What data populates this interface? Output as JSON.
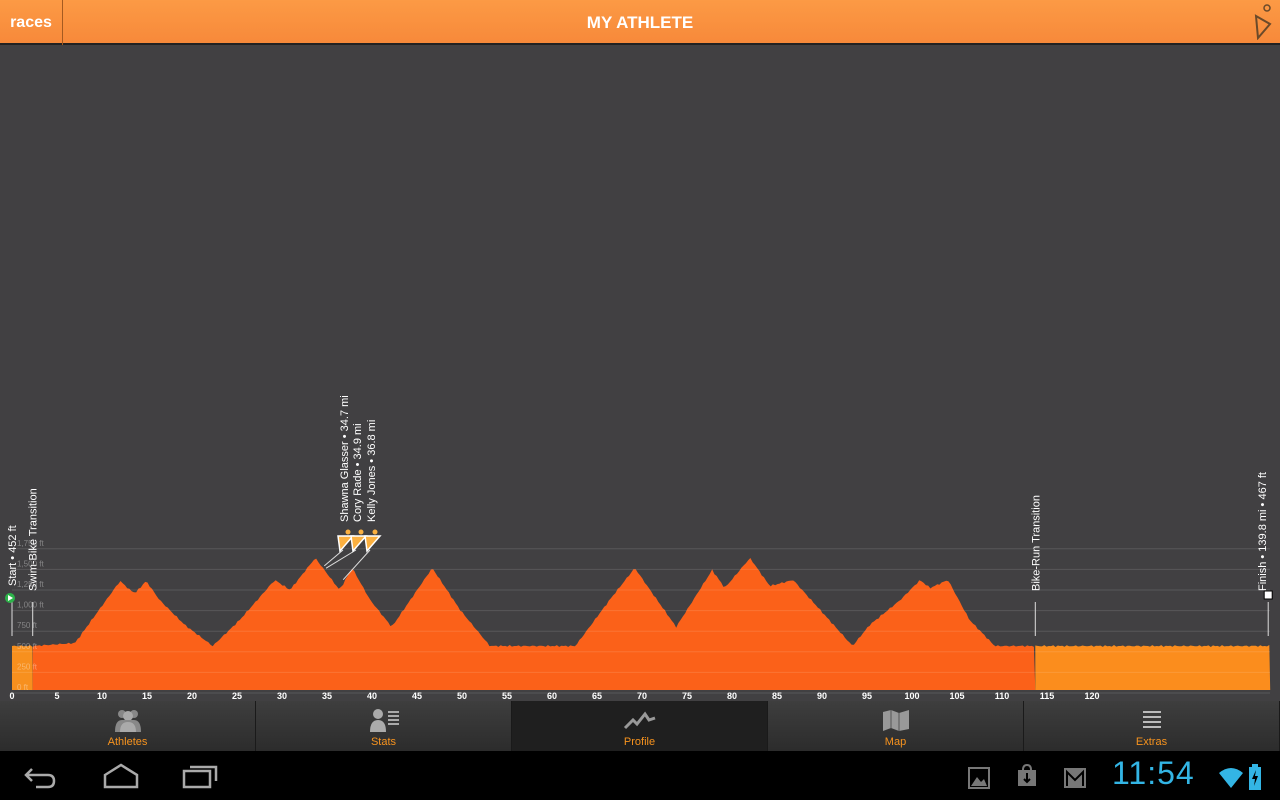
{
  "header": {
    "back_label": "races",
    "title": "MY ATHLETE"
  },
  "chart_data": {
    "type": "area",
    "xlabel": "",
    "ylabel": "",
    "x_unit": "mi",
    "y_unit": "ft",
    "xlim": [
      0,
      139.8
    ],
    "ylim": [
      0,
      1750
    ],
    "x_ticks": [
      0,
      5,
      10,
      15,
      20,
      25,
      30,
      35,
      40,
      45,
      50,
      55,
      60,
      65,
      70,
      75,
      80,
      85,
      90,
      95,
      100,
      105,
      110,
      115,
      120
    ],
    "y_ticks": [
      "0 ft",
      "250 ft",
      "500 ft",
      "750 ft",
      "1,000 ft",
      "1,250 ft",
      "1,500 ft",
      "1,750 ft"
    ],
    "y_tick_values": [
      0,
      250,
      500,
      750,
      1000,
      1250,
      1500,
      1750
    ],
    "grid": true,
    "profile": [
      [
        0,
        534
      ],
      [
        2.3,
        534
      ],
      [
        7,
        570
      ],
      [
        12,
        1323
      ],
      [
        13.1,
        1214
      ],
      [
        13.7,
        1177
      ],
      [
        14.9,
        1323
      ],
      [
        16.4,
        1092
      ],
      [
        19.2,
        789
      ],
      [
        22.3,
        534
      ],
      [
        25.3,
        850
      ],
      [
        29.2,
        1335
      ],
      [
        30.9,
        1214
      ],
      [
        33.7,
        1602
      ],
      [
        36.4,
        1214
      ],
      [
        37.8,
        1481
      ],
      [
        39.8,
        1092
      ],
      [
        42.2,
        765
      ],
      [
        46.7,
        1481
      ],
      [
        49.8,
        971
      ],
      [
        53.1,
        534
      ],
      [
        62.6,
        534
      ],
      [
        66.4,
        1092
      ],
      [
        69.2,
        1481
      ],
      [
        70.9,
        1214
      ],
      [
        73.8,
        765
      ],
      [
        77.8,
        1456
      ],
      [
        79.2,
        1238
      ],
      [
        82,
        1602
      ],
      [
        84.2,
        1262
      ],
      [
        86.8,
        1335
      ],
      [
        89.8,
        971
      ],
      [
        93.4,
        534
      ],
      [
        95.3,
        789
      ],
      [
        98.7,
        1092
      ],
      [
        100.9,
        1335
      ],
      [
        102,
        1238
      ],
      [
        104,
        1335
      ],
      [
        106.4,
        850
      ],
      [
        109.2,
        534
      ],
      [
        113.7,
        534
      ],
      [
        139.8,
        534
      ]
    ],
    "segments": [
      {
        "from": 0,
        "to": 2.3,
        "color": "#f7901e"
      },
      {
        "from": 2.3,
        "to": 113.7,
        "color": "#fb6119"
      },
      {
        "from": 113.7,
        "to": 139.8,
        "color": "#fb8d1d"
      }
    ],
    "markers": [
      {
        "mile": 0,
        "label": "Start • 452 ft",
        "icon": "start-flag"
      },
      {
        "mile": 2.3,
        "label": "Swim-Bike Transition"
      },
      {
        "mile": 113.7,
        "label": "Bike-Run Transition"
      },
      {
        "mile": 139.8,
        "label": "Finish • 139.8 mi • 467 ft",
        "icon": "checkered-flag"
      }
    ],
    "athletes": [
      {
        "mile": 34.7,
        "label": "Shawna Glasser • 34.7 mi"
      },
      {
        "mile": 34.9,
        "label": "Cory Rade • 34.9 mi"
      },
      {
        "mile": 36.8,
        "label": "Kelly Jones • 36.8 mi"
      }
    ]
  },
  "tabs": [
    {
      "label": "Athletes",
      "icon": "athletes-icon"
    },
    {
      "label": "Stats",
      "icon": "stats-icon"
    },
    {
      "label": "Profile",
      "icon": "profile-icon",
      "active": true
    },
    {
      "label": "Map",
      "icon": "map-icon"
    },
    {
      "label": "Extras",
      "icon": "extras-icon"
    }
  ],
  "system": {
    "time": "11:54"
  }
}
